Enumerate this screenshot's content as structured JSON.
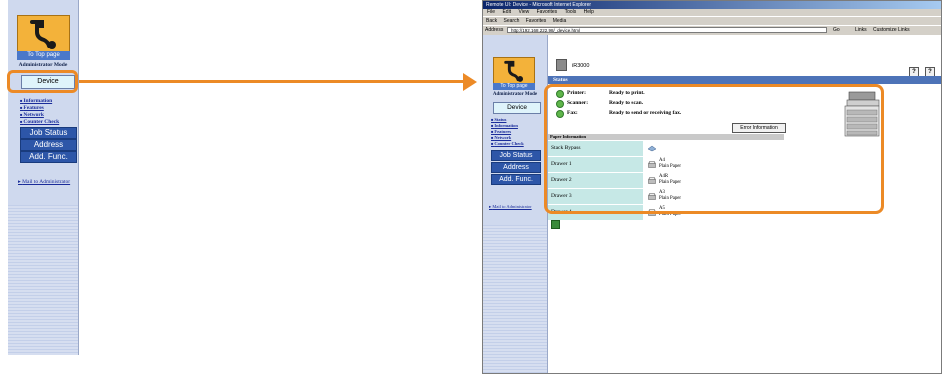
{
  "left_panel": {
    "logo_label": "To Top page",
    "admin_mode": "Administrator Mode",
    "device_label": "Device",
    "links": [
      "Information",
      "Features",
      "Network",
      "Counter Check"
    ],
    "nav_buttons": [
      "Job Status",
      "Address",
      "Add. Func."
    ],
    "mail_link": "Mail to Administrator"
  },
  "browser": {
    "title": "Remote UI: Device - Microsoft Internet Explorer",
    "menu": [
      "File",
      "Edit",
      "View",
      "Favorites",
      "Tools",
      "Help"
    ],
    "toolbar": [
      "Back",
      "Search",
      "Favorites",
      "Media"
    ],
    "address_label": "Address",
    "address_value": "http://192.168.222.98/_device.html",
    "go_label": "Go",
    "links_label": "Links",
    "customize_label": "Customize Links"
  },
  "page": {
    "sidebar": {
      "logo_label": "To Top page",
      "admin_mode": "Administrator Mode",
      "device_label": "Device",
      "links": [
        "Status",
        "Information",
        "Features",
        "Network",
        "Counter Check"
      ],
      "nav_buttons": [
        "Job Status",
        "Address",
        "Add. Func."
      ],
      "mail_link": "Mail to Administrator"
    },
    "model": "iR3000",
    "help_icons": [
      "?",
      "?"
    ],
    "status_header": "Status",
    "status_rows": [
      {
        "label": "Printer:",
        "value": "Ready to print."
      },
      {
        "label": "Scanner:",
        "value": "Ready to scan."
      },
      {
        "label": "Fax:",
        "value": "Ready to send or receiving fax."
      }
    ],
    "error_button": "Error Information",
    "paper_header": "Paper Information",
    "paper_rows": [
      {
        "name": "Stack Bypass",
        "size": "",
        "type": ""
      },
      {
        "name": "Drawer 1",
        "size": "A4",
        "type": "Plain Paper"
      },
      {
        "name": "Drawer 2",
        "size": "A4R",
        "type": "Plain Paper"
      },
      {
        "name": "Drawer 3",
        "size": "A3",
        "type": "Plain Paper"
      },
      {
        "name": "Drawer 4",
        "size": "A5",
        "type": "Plain Paper"
      }
    ]
  },
  "colors": {
    "highlight": "#ec8a26",
    "nav_blue": "#2d56a8",
    "status_bar": "#4d73b8",
    "paper_cell": "#c6e8e6",
    "status_ok": "#5fb54a"
  }
}
